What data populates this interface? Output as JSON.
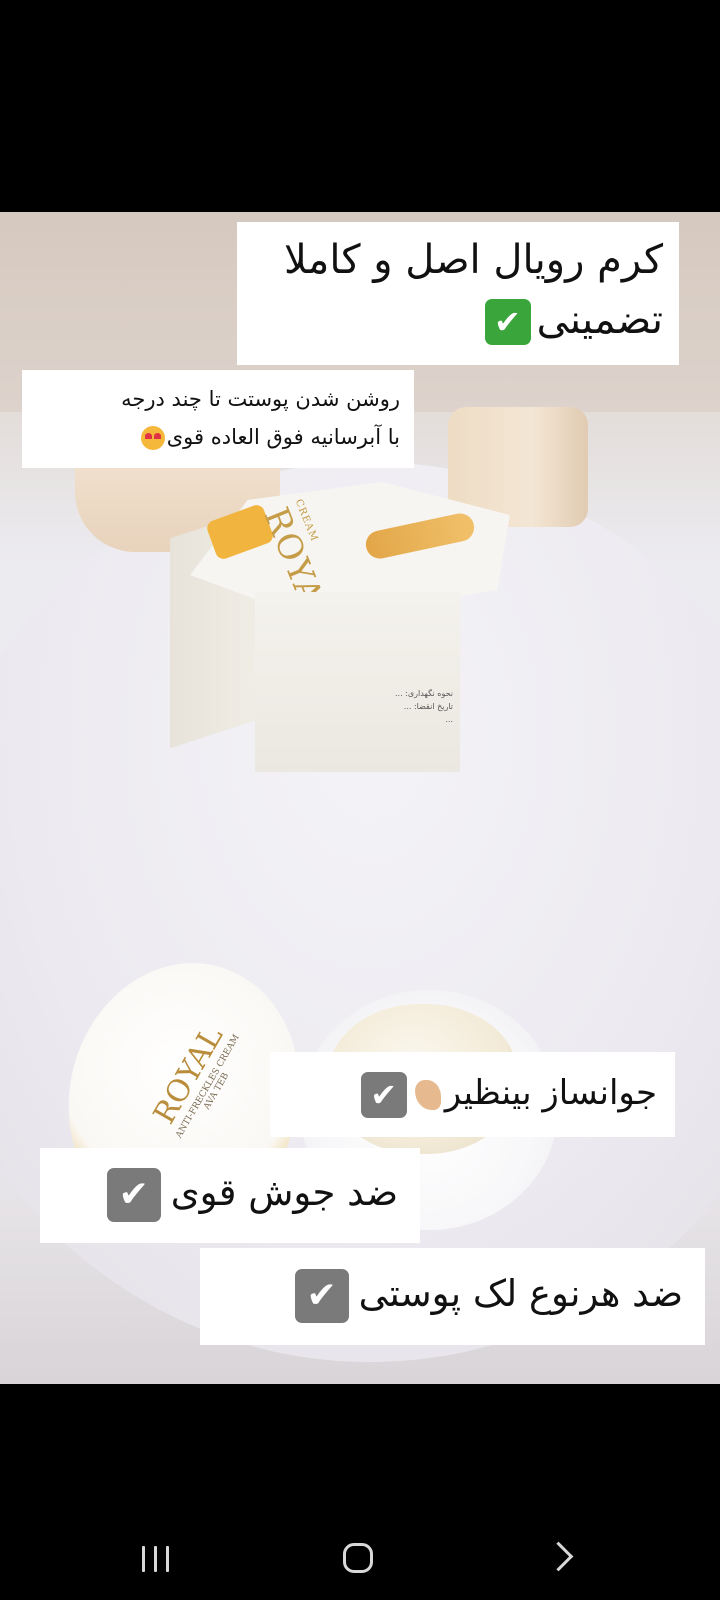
{
  "ad": {
    "headline": {
      "line1": "کرم رویال اصل و کاملا",
      "line2": "تضمینی",
      "check_icon": "green-check-mark-icon"
    },
    "subheadline": {
      "line1": "روشن شدن پوستت تا چند درجه",
      "line2": "با آبرسانیه فوق العاده قوی",
      "emoji_icon": "heart-eyes-emoji-icon"
    },
    "features": [
      {
        "text": "جوانساز بینظیر",
        "check_icon": "check-mark-icon",
        "emoji_icon": "flexed-biceps-emoji-icon"
      },
      {
        "text": "ضد جوش قوی",
        "check_icon": "check-mark-icon"
      },
      {
        "text": "ضد هرنوع لک پوستی",
        "check_icon": "check-mark-icon"
      }
    ],
    "product": {
      "box_brand_small": "CREAM",
      "box_brand": "ROYAL",
      "box_text_lines": [
        "نحوه نگهداری: ...",
        "تاریخ انقضا: ...",
        "..."
      ],
      "lid_brand": "ROYAL",
      "lid_line1": "ANTI-FRECKLES CREAM",
      "lid_line2": "AVA TEB"
    },
    "colors": {
      "card_background": "#ffffff",
      "check_green": "#3aa53a",
      "check_gray": "#7a7a7a",
      "gold_accent": "#c59c48"
    }
  },
  "navigation_bar": {
    "recent_apps": "recent-apps-icon",
    "home": "home-icon",
    "back": "back-icon"
  }
}
